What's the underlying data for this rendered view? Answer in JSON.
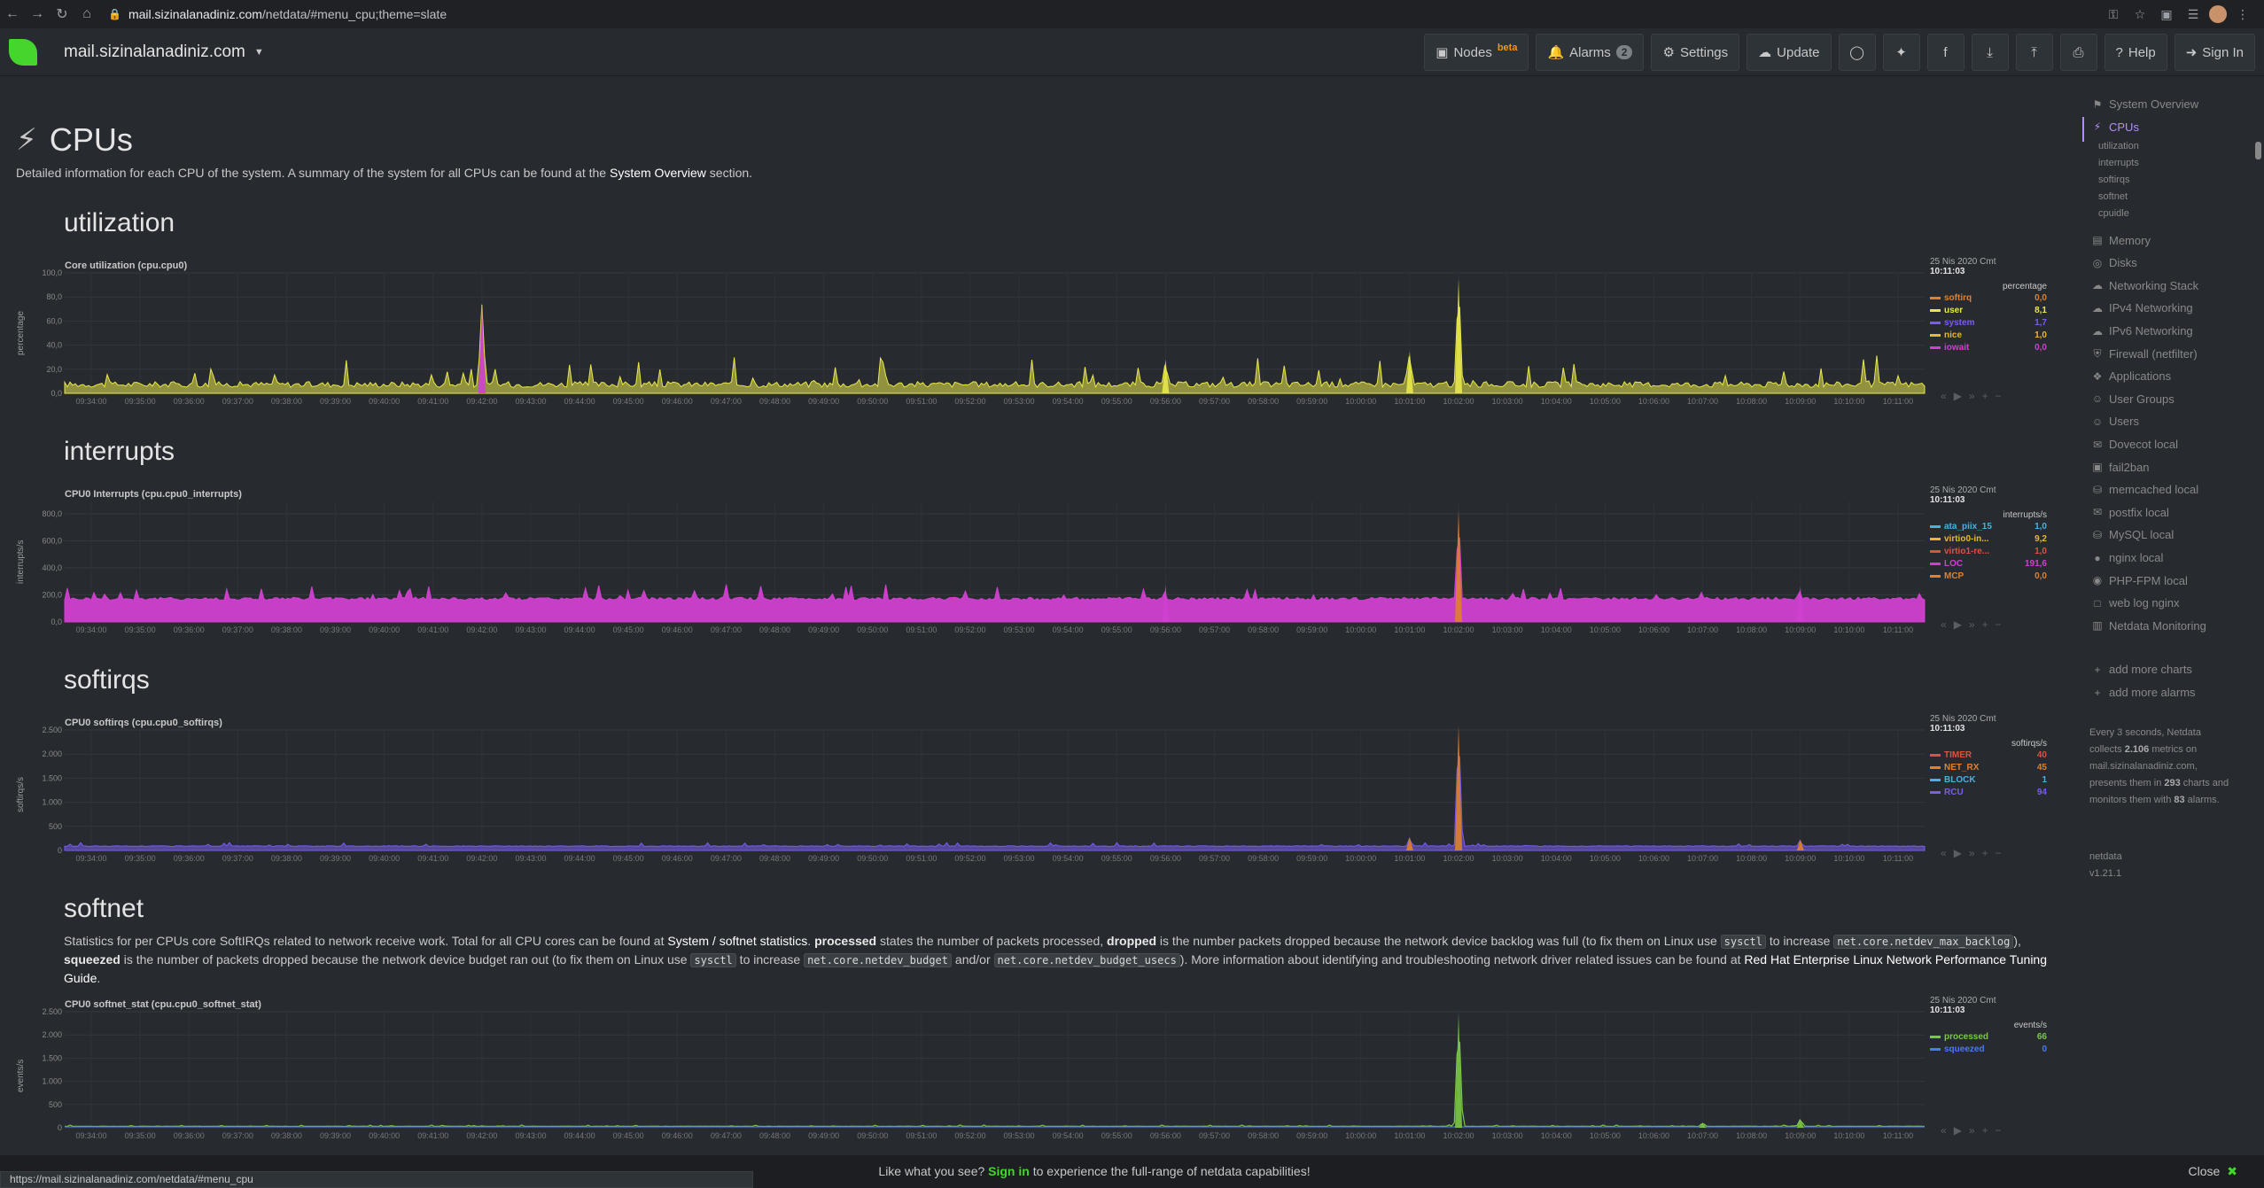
{
  "browser": {
    "url_host": "mail.sizinalanadiniz.com",
    "url_path": "/netdata/#menu_cpu;theme=slate"
  },
  "navbar": {
    "hostname": "mail.sizinalanadiniz.com",
    "nodes_label": "Nodes",
    "nodes_beta": "beta",
    "alarms_label": "Alarms",
    "alarms_count": "2",
    "settings_label": "Settings",
    "update_label": "Update",
    "help_label": "Help",
    "signin_label": "Sign In"
  },
  "section": {
    "title": "CPUs",
    "desc_pre": "Detailed information for each CPU of the system. A summary of the system for all CPUs can be found at the ",
    "desc_link": "System Overview",
    "desc_post": " section."
  },
  "subsections": {
    "utilization": "utilization",
    "interrupts": "interrupts",
    "softirqs": "softirqs",
    "softnet": "softnet"
  },
  "softnet_desc": {
    "p1": "Statistics for per CPUs core SoftIRQs related to network receive work. Total for all CPU cores can be found at ",
    "link1": "System / softnet statistics",
    "p2": ". ",
    "b1": "processed",
    "p3": " states the number of packets processed, ",
    "b2": "dropped",
    "p4": " is the number packets dropped because the network device backlog was full (to fix them on Linux use ",
    "c1": "sysctl",
    "p5": " to increase ",
    "c2": "net.core.netdev_max_backlog",
    "p6": "), ",
    "b3": "squeezed",
    "p7": " is the number of packets dropped because the network device budget ran out (to fix them on Linux use ",
    "c3": "sysctl",
    "p8": " to increase ",
    "c4": "net.core.netdev_budget",
    "p9": " and/or ",
    "c5": "net.core.netdev_budget_usecs",
    "p10": "). More information about identifying and troubleshooting network driver related issues can be found at ",
    "link2": "Red Hat Enterprise Linux Network Performance Tuning Guide",
    "p11": "."
  },
  "legend_common": {
    "date": "25 Nis 2020 Cmt",
    "time": "10:11:03"
  },
  "time_ticks": [
    "09:34:00",
    "09:35:00",
    "09:36:00",
    "09:37:00",
    "09:38:00",
    "09:39:00",
    "09:40:00",
    "09:41:00",
    "09:42:00",
    "09:43:00",
    "09:44:00",
    "09:45:00",
    "09:46:00",
    "09:47:00",
    "09:48:00",
    "09:49:00",
    "09:50:00",
    "09:51:00",
    "09:52:00",
    "09:53:00",
    "09:54:00",
    "09:55:00",
    "09:56:00",
    "09:57:00",
    "09:58:00",
    "09:59:00",
    "10:00:00",
    "10:01:00",
    "10:02:00",
    "10:03:00",
    "10:04:00",
    "10:05:00",
    "10:06:00",
    "10:07:00",
    "10:08:00",
    "10:09:00",
    "10:10:00",
    "10:11:00"
  ],
  "chart_data": [
    {
      "type": "area",
      "title": "Core utilization (cpu.cpu0)",
      "ylabel": "percentage",
      "units": "percentage",
      "ylim": [
        0,
        100
      ],
      "yticks": [
        "100,0",
        "80,0",
        "60,0",
        "40,0",
        "20,0",
        "0,0"
      ],
      "series": [
        {
          "name": "softirq",
          "color": "#e0802e",
          "value": "0,0"
        },
        {
          "name": "user",
          "color": "#e8e84a",
          "value": "8,1"
        },
        {
          "name": "system",
          "color": "#7a5cf0",
          "value": "1,7"
        },
        {
          "name": "nice",
          "color": "#e8b830",
          "value": "1,0"
        },
        {
          "name": "iowait",
          "color": "#d040d0",
          "value": "0,0"
        }
      ],
      "spikes": [
        {
          "t": "09:42:00",
          "value": 75,
          "color": "#d040d0"
        },
        {
          "t": "10:02:00",
          "value": 95,
          "color": "#e8e84a"
        },
        {
          "t": "10:01:00",
          "value": 35,
          "color": "#e8e84a"
        },
        {
          "t": "09:56:00",
          "value": 28,
          "color": "#e8e84a"
        }
      ],
      "baseline": 5,
      "noise": 12
    },
    {
      "type": "area",
      "title": "CPU0 Interrupts (cpu.cpu0_interrupts)",
      "ylabel": "interrupts/s",
      "units": "interrupts/s",
      "ylim": [
        0,
        950
      ],
      "yticks": [
        "800,0",
        "600,0",
        "400,0",
        "200,0",
        "0,0"
      ],
      "series": [
        {
          "name": "ata_piix_15",
          "color": "#4ab0e0",
          "value": "1,0"
        },
        {
          "name": "virtio0-in...",
          "color": "#e8b830",
          "value": "9,2"
        },
        {
          "name": "virtio1-re...",
          "color": "#e05040",
          "value": "1,0"
        },
        {
          "name": "LOC",
          "color": "#d040d0",
          "value": "191,6"
        },
        {
          "name": "MCP",
          "color": "#e0802e",
          "value": "0,0"
        }
      ],
      "spikes": [
        {
          "t": "10:02:00",
          "value": 880,
          "color": "#e0802e"
        },
        {
          "t": "09:56:00",
          "value": 290,
          "color": "#d040d0"
        },
        {
          "t": "10:09:00",
          "value": 280,
          "color": "#d040d0"
        }
      ],
      "baseline": 170,
      "noise": 60
    },
    {
      "type": "area",
      "title": "CPU0 softirqs (cpu.cpu0_softirqs)",
      "ylabel": "softirqs/s",
      "units": "softirqs/s",
      "ylim": [
        0,
        2700
      ],
      "yticks": [
        "2.500",
        "2.000",
        "1.500",
        "1.000",
        "500",
        "0"
      ],
      "series": [
        {
          "name": "TIMER",
          "color": "#e05040",
          "value": "40"
        },
        {
          "name": "NET_RX",
          "color": "#e0802e",
          "value": "45"
        },
        {
          "name": "BLOCK",
          "color": "#4ab0e0",
          "value": "1"
        },
        {
          "name": "RCU",
          "color": "#7a5cf0",
          "value": "94"
        }
      ],
      "spikes": [
        {
          "t": "10:02:00",
          "value": 2800,
          "color": "#e0802e"
        },
        {
          "t": "10:01:00",
          "value": 300,
          "color": "#e0802e"
        },
        {
          "t": "10:09:00",
          "value": 250,
          "color": "#e0802e"
        }
      ],
      "baseline": 90,
      "noise": 40
    },
    {
      "type": "line",
      "title": "CPU0 softnet_stat (cpu.cpu0_softnet_stat)",
      "ylabel": "events/s",
      "units": "events/s",
      "ylim": [
        0,
        2600
      ],
      "yticks": [
        "2.500",
        "2.000",
        "1.500",
        "1.000",
        "500",
        "0"
      ],
      "series": [
        {
          "name": "processed",
          "color": "#7ac943",
          "value": "66"
        },
        {
          "name": "squeezed",
          "color": "#4a7af0",
          "value": "0"
        }
      ],
      "spikes": [
        {
          "t": "10:02:00",
          "value": 2550,
          "color": "#7ac943"
        },
        {
          "t": "10:09:00",
          "value": 200,
          "color": "#7ac943"
        },
        {
          "t": "10:07:00",
          "value": 120,
          "color": "#7ac943"
        }
      ],
      "baseline": 30,
      "noise": 15
    }
  ],
  "sidebar": {
    "items": [
      {
        "label": "System Overview",
        "icon": "bookmark-icon"
      },
      {
        "label": "CPUs",
        "icon": "bolt-icon"
      },
      {
        "label": "Memory",
        "icon": "memory-icon"
      },
      {
        "label": "Disks",
        "icon": "disk-icon"
      },
      {
        "label": "Networking Stack",
        "icon": "cloud-icon"
      },
      {
        "label": "IPv4 Networking",
        "icon": "cloud-icon"
      },
      {
        "label": "IPv6 Networking",
        "icon": "cloud-icon"
      },
      {
        "label": "Firewall (netfilter)",
        "icon": "shield-icon"
      },
      {
        "label": "Applications",
        "icon": "puzzle-icon"
      },
      {
        "label": "User Groups",
        "icon": "users-icon"
      },
      {
        "label": "Users",
        "icon": "user-icon"
      },
      {
        "label": "Dovecot local",
        "icon": "envelope-icon"
      },
      {
        "label": "fail2ban",
        "icon": "folder-icon"
      },
      {
        "label": "memcached local",
        "icon": "database-icon"
      },
      {
        "label": "postfix local",
        "icon": "envelope-icon"
      },
      {
        "label": "MySQL local",
        "icon": "database-icon"
      },
      {
        "label": "nginx local",
        "icon": "globe-icon"
      },
      {
        "label": "PHP-FPM local",
        "icon": "eye-icon"
      },
      {
        "label": "web log nginx",
        "icon": "file-icon"
      },
      {
        "label": "Netdata Monitoring",
        "icon": "chart-icon"
      }
    ],
    "subitems": [
      "utilization",
      "interrupts",
      "softirqs",
      "softnet",
      "cpuidle"
    ],
    "add_charts": "add more charts",
    "add_alarms": "add more alarms",
    "note_pre": "Every 3 seconds, Netdata collects ",
    "note_metrics": "2.106",
    "note_mid": " metrics on mail.sizinalanadiniz.com, presents them in ",
    "note_charts": "293",
    "note_mid2": " charts and monitors them with ",
    "note_alarms": "83",
    "note_post": " alarms.",
    "brand": "netdata",
    "version": "v1.21.1"
  },
  "footer": {
    "pre": "Like what you see? ",
    "link": "Sign in",
    "post": " to experience the full-range of netdata capabilities!",
    "close": "Close"
  },
  "status_url": "https://mail.sizinalanadiniz.com/netdata/#menu_cpu"
}
